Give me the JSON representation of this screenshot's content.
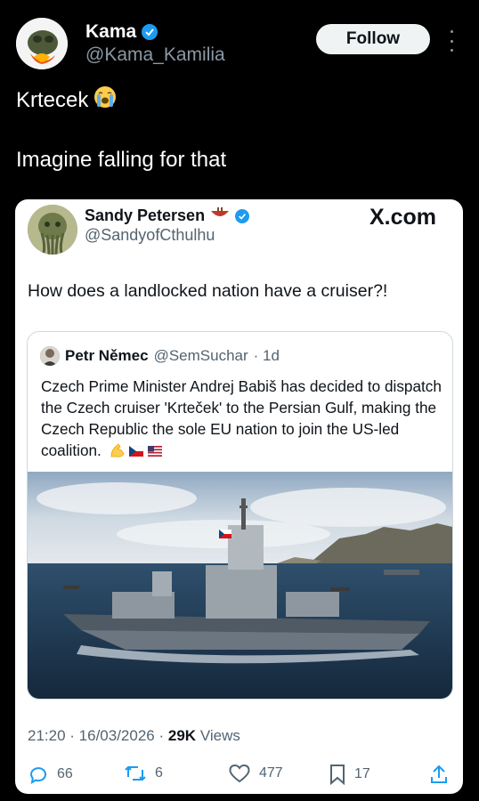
{
  "author": {
    "name": "Kama",
    "handle": "@Kama_Kamilia",
    "follow_label": "Follow"
  },
  "tweet": {
    "line1": "Krtecek",
    "line2": "Imagine falling for that"
  },
  "embedded": {
    "author_name": "Sandy Petersen",
    "author_handle": "@SandyofCthulhu",
    "site_label": "X.com",
    "text": "How does a landlocked nation have a cruiser?!",
    "quoted": {
      "author_name": "Petr Němec",
      "author_handle": "@SemSuchar",
      "time": "· 1d",
      "text": "Czech Prime Minister Andrej Babiš has decided to dispatch the Czech cruiser 'Krteček' to the Persian Gulf, making the Czech Republic the sole EU nation to join the US-led coalition."
    },
    "meta": {
      "time": "21:20",
      "date": "16/03/2026",
      "views_count": "29K",
      "views_label": "Views"
    },
    "actions": {
      "replies": "66",
      "reposts": "6",
      "likes": "477",
      "bookmarks": "17"
    }
  },
  "colors": {
    "background": "#000000",
    "verified": "#1d9bf0",
    "muted": "#8b98a5",
    "card_bg": "#ffffff"
  },
  "icons": [
    "verified-icon",
    "loudly-crying-emoji",
    "more-icon",
    "bowl-emoji",
    "flexed-biceps-emoji",
    "czech-flag-emoji",
    "us-flag-emoji",
    "reply-icon",
    "repost-icon",
    "like-icon",
    "bookmark-icon",
    "share-icon"
  ]
}
